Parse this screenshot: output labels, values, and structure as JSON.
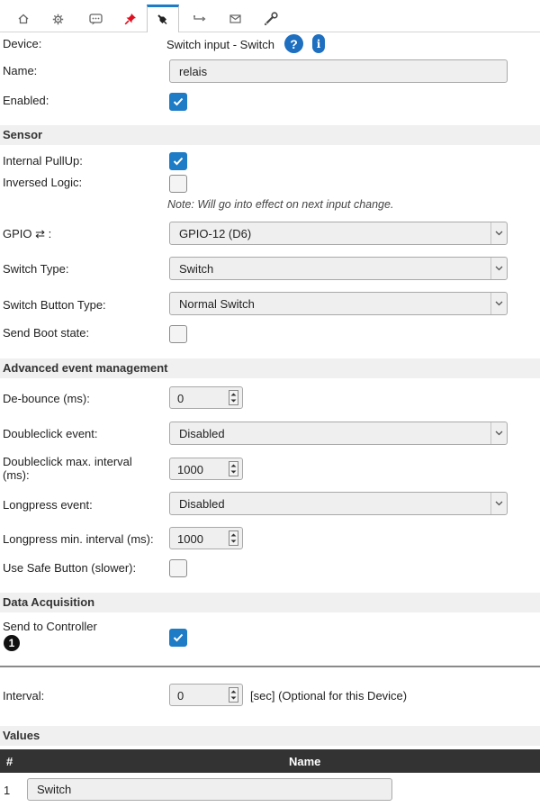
{
  "tabs": [
    {
      "icon": "home-icon"
    },
    {
      "icon": "gear-icon"
    },
    {
      "icon": "chat-icon"
    },
    {
      "icon": "pin-icon"
    },
    {
      "icon": "plug-icon",
      "active": true
    },
    {
      "icon": "arrows-icon"
    },
    {
      "icon": "mail-icon"
    },
    {
      "icon": "wrench-icon"
    }
  ],
  "device": {
    "label": "Device:",
    "value": "Switch input - Switch",
    "help": "?",
    "info": "i"
  },
  "name": {
    "label": "Name:",
    "value": "relais"
  },
  "enabled": {
    "label": "Enabled:",
    "checked": true
  },
  "sensor": {
    "title": "Sensor",
    "pullup": {
      "label": "Internal PullUp:",
      "checked": true
    },
    "inversed": {
      "label": "Inversed Logic:",
      "checked": false
    },
    "note": "Note: Will go into effect on next input change.",
    "gpio": {
      "label": "GPIO ⇄ :",
      "value": "GPIO-12 (D6)"
    },
    "switch_type": {
      "label": "Switch Type:",
      "value": "Switch"
    },
    "button_type": {
      "label": "Switch Button Type:",
      "value": "Normal Switch"
    },
    "boot_state": {
      "label": "Send Boot state:",
      "checked": false
    }
  },
  "advanced": {
    "title": "Advanced event management",
    "debounce": {
      "label": "De-bounce (ms):",
      "value": "0"
    },
    "doubleclick": {
      "label": "Doubleclick event:",
      "value": "Disabled"
    },
    "dc_interval": {
      "label_line1": "Doubleclick max. interval",
      "label_line2": "(ms):",
      "value": "1000"
    },
    "longpress": {
      "label": "Longpress event:",
      "value": "Disabled"
    },
    "lp_interval": {
      "label": "Longpress min. interval (ms):",
      "value": "1000"
    },
    "safe_button": {
      "label": "Use Safe Button (slower):",
      "checked": false
    }
  },
  "acquisition": {
    "title": "Data Acquisition",
    "send": {
      "label": "Send to Controller",
      "badge": "1",
      "checked": true
    },
    "interval": {
      "label": "Interval:",
      "value": "0",
      "suffix": "[sec] (Optional for this Device)"
    }
  },
  "values": {
    "title": "Values",
    "columns": [
      "#",
      "Name"
    ],
    "rows": [
      {
        "index": "1",
        "name": "Switch"
      }
    ]
  },
  "colors": {
    "accent": "#1e7bc6",
    "section_bg": "#f0f0f0",
    "table_header": "#333333"
  }
}
